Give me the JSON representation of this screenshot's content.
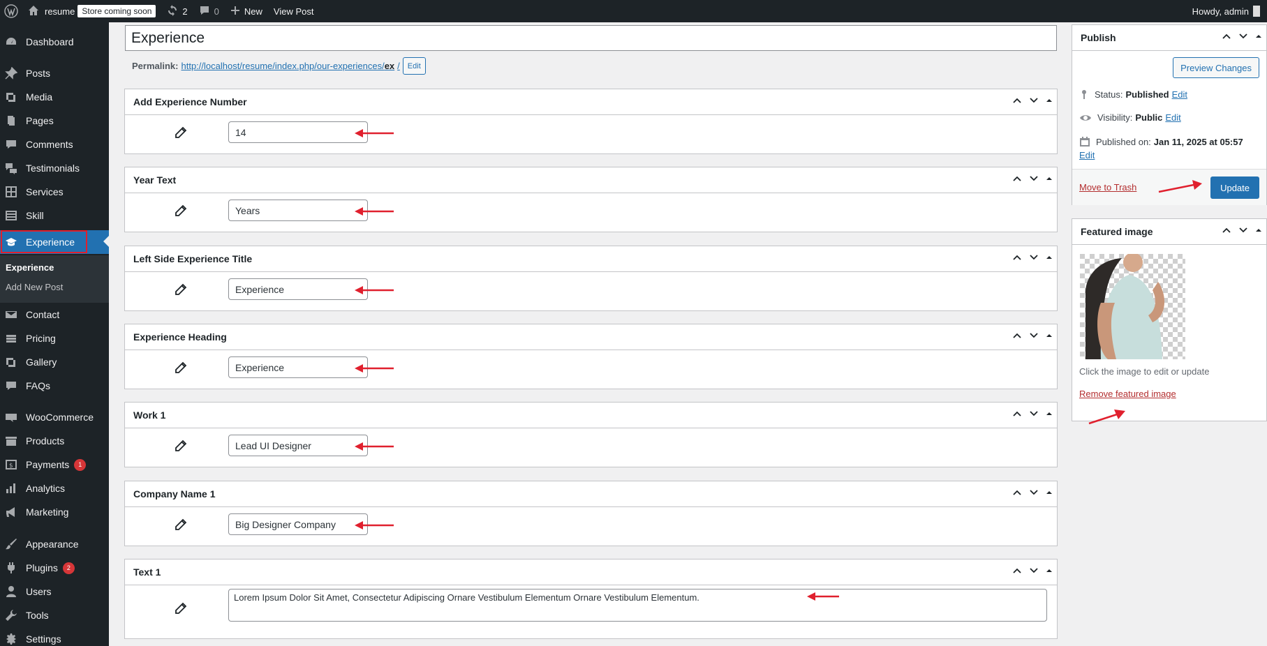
{
  "adminbar": {
    "site_name": "resume",
    "store_badge": "Store coming soon",
    "updates_count": "2",
    "comments_count": "0",
    "new_label": "New",
    "view_post_label": "View Post",
    "howdy": "Howdy, admin"
  },
  "sidebar": {
    "items": [
      {
        "label": "Dashboard",
        "icon": "dashboard-icon"
      },
      {
        "label": "Posts",
        "icon": "pin-icon"
      },
      {
        "label": "Media",
        "icon": "media-icon"
      },
      {
        "label": "Pages",
        "icon": "pages-icon"
      },
      {
        "label": "Comments",
        "icon": "comment-icon"
      },
      {
        "label": "Testimonials",
        "icon": "testimonials-icon"
      },
      {
        "label": "Services",
        "icon": "grid-icon"
      },
      {
        "label": "Skill",
        "icon": "list-icon"
      },
      {
        "label": "Experience",
        "icon": "mortarboard-icon"
      },
      {
        "label": "Contact",
        "icon": "mail-icon"
      },
      {
        "label": "Pricing",
        "icon": "stack-icon"
      },
      {
        "label": "Gallery",
        "icon": "gallery-icon"
      },
      {
        "label": "FAQs",
        "icon": "comment-icon"
      },
      {
        "label": "WooCommerce",
        "icon": "woo-icon"
      },
      {
        "label": "Products",
        "icon": "archive-icon"
      },
      {
        "label": "Payments",
        "icon": "dollar-icon",
        "badge": "1"
      },
      {
        "label": "Analytics",
        "icon": "chart-bar-icon"
      },
      {
        "label": "Marketing",
        "icon": "megaphone-icon"
      },
      {
        "label": "Appearance",
        "icon": "brush-icon"
      },
      {
        "label": "Plugins",
        "icon": "plug-icon",
        "badge": "2"
      },
      {
        "label": "Users",
        "icon": "user-icon"
      },
      {
        "label": "Tools",
        "icon": "wrench-icon"
      },
      {
        "label": "Settings",
        "icon": "settings-icon"
      }
    ],
    "submenu": {
      "current": "Experience",
      "add_new": "Add New Post"
    }
  },
  "editor": {
    "title": "Experience",
    "permalink_label": "Permalink:",
    "permalink_url": "http://localhost/resume/index.php/our-experiences/",
    "permalink_slug": "ex",
    "permalink_trailing": "/",
    "permalink_edit": "Edit"
  },
  "metaboxes": [
    {
      "title": "Add Experience Number",
      "value": "14"
    },
    {
      "title": "Year Text",
      "value": "Years"
    },
    {
      "title": "Left Side Experience Title",
      "value": "Experience"
    },
    {
      "title": "Experience Heading",
      "value": "Experience"
    },
    {
      "title": "Work 1",
      "value": "Lead UI Designer"
    },
    {
      "title": "Company Name 1",
      "value": "Big Designer Company"
    },
    {
      "title": "Text 1",
      "value": "Lorem Ipsum Dolor Sit Amet, Consectetur Adipiscing Ornare Vestibulum Elementum  Ornare Vestibulum Elementum."
    }
  ],
  "publish": {
    "title": "Publish",
    "preview_label": "Preview Changes",
    "status_label": "Status:",
    "status_value": "Published",
    "visibility_label": "Visibility:",
    "visibility_value": "Public",
    "published_label": "Published on:",
    "published_value": "Jan 11, 2025 at 05:57",
    "edit_label": "Edit",
    "trash_label": "Move to Trash",
    "update_label": "Update"
  },
  "featured_image": {
    "title": "Featured image",
    "note": "Click the image to edit or update",
    "remove_label": "Remove featured image"
  },
  "colors": {
    "accent": "#2271b1",
    "annotation_red": "#e0202e",
    "sidebar_bg": "#1d2327"
  }
}
